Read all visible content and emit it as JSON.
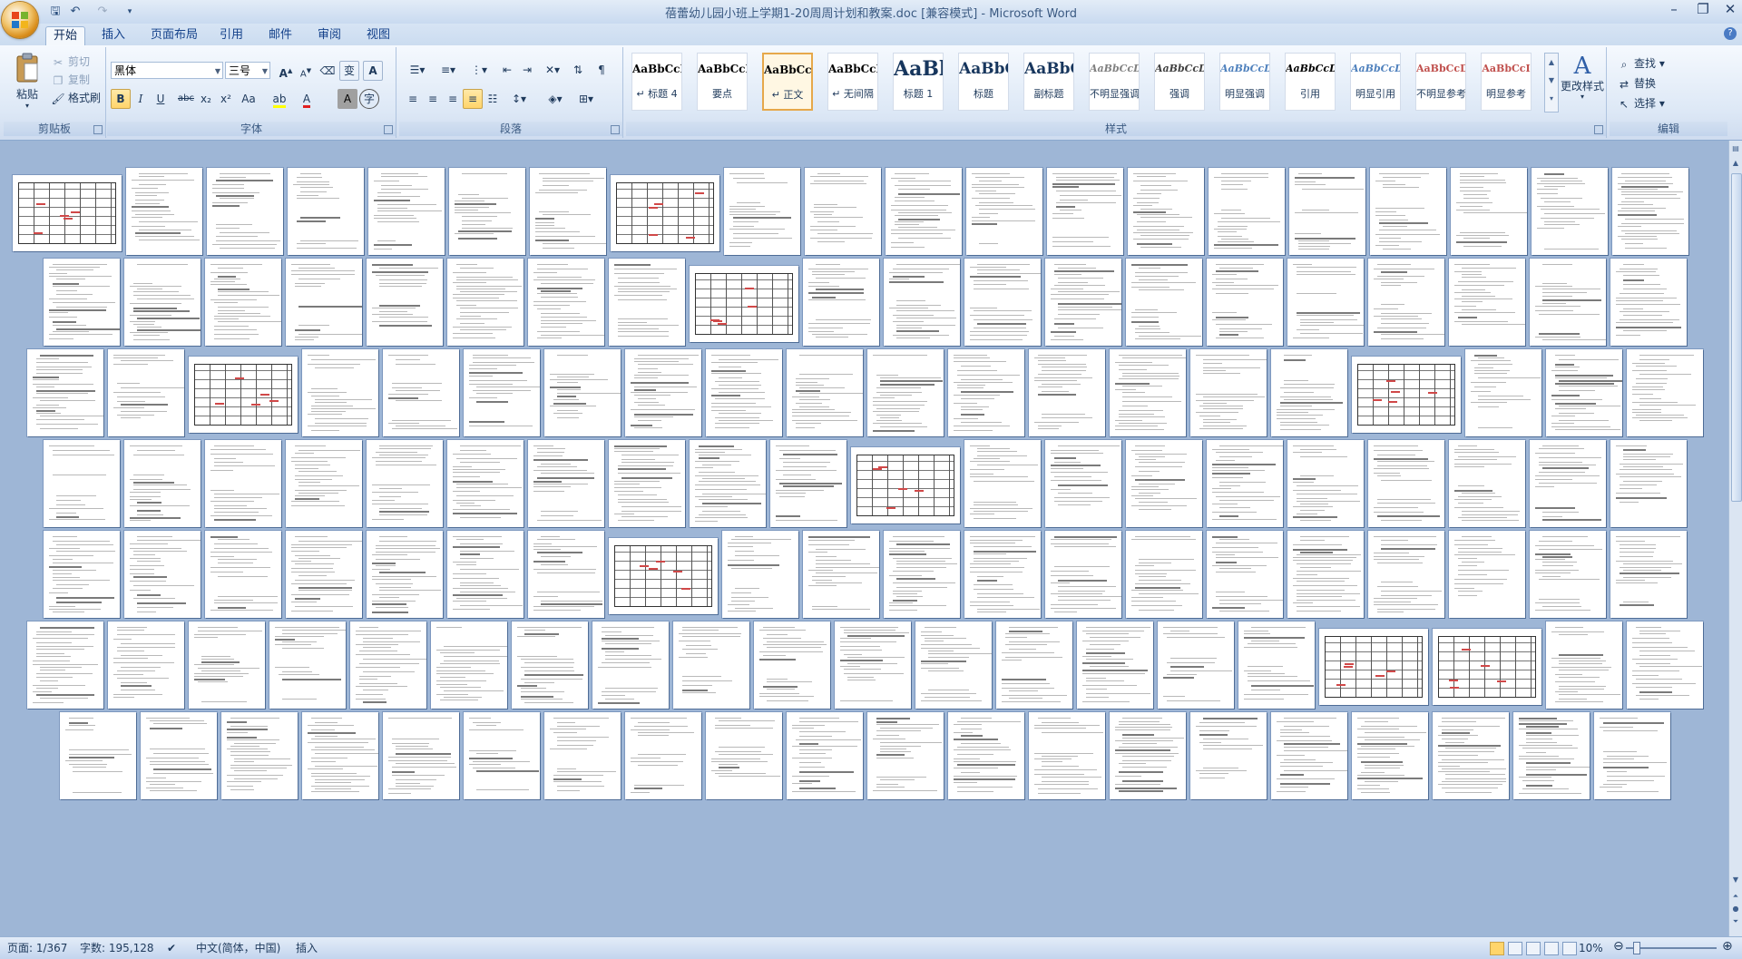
{
  "window": {
    "title": "蓓蕾幼儿园小班上学期1-20周周计划和教案.doc [兼容模式] - Microsoft Word"
  },
  "tabs": [
    "开始",
    "插入",
    "页面布局",
    "引用",
    "邮件",
    "审阅",
    "视图"
  ],
  "clipboard": {
    "paste": "粘贴",
    "cut": "剪切",
    "copy": "复制",
    "format_painter": "格式刷",
    "label": "剪贴板"
  },
  "font": {
    "name": "黑体",
    "size": "三号",
    "label": "字体",
    "grow": "A",
    "shrink": "A",
    "bold": "B",
    "italic": "I",
    "underline": "U",
    "strike": "abc",
    "subscript": "x₂",
    "superscript": "x²",
    "change_case": "Aa",
    "font_color": "A",
    "char_shading": "A",
    "clear": "A",
    "phonetic": "变"
  },
  "paragraph": {
    "label": "段落"
  },
  "styles": {
    "label": "样式",
    "items": [
      {
        "sample": "AaBbCcI",
        "name": "↵ 标题 4"
      },
      {
        "sample": "AaBbCcD",
        "name": "要点"
      },
      {
        "sample": "AaBbCcDc",
        "name": "↵ 正文"
      },
      {
        "sample": "AaBbCcDc",
        "name": "↵ 无间隔"
      },
      {
        "sample": "AaBl",
        "name": "标题 1"
      },
      {
        "sample": "AaBbC(",
        "name": "标题"
      },
      {
        "sample": "AaBbC",
        "name": "副标题"
      },
      {
        "sample": "AaBbCcDi",
        "name": "不明显强调"
      },
      {
        "sample": "AaBbCcDi",
        "name": "强调"
      },
      {
        "sample": "AaBbCcDi",
        "name": "明显强调"
      },
      {
        "sample": "AaBbCcDi",
        "name": "引用"
      },
      {
        "sample": "AaBbCcDi",
        "name": "明显引用"
      },
      {
        "sample": "AaBbCcD",
        "name": "不明显参考"
      },
      {
        "sample": "AaBbCcI",
        "name": "明显参考"
      }
    ],
    "change_styles": "更改样式"
  },
  "editing": {
    "label": "编辑",
    "find": "查找",
    "replace": "替换",
    "select": "选择"
  },
  "status": {
    "page": "页面: 1/367",
    "words": "字数: 195,128",
    "language": "中文(简体，中国)",
    "mode": "插入",
    "zoom": "10%",
    "zoom_level": 0.1
  },
  "colors": {
    "ribbon_bg": "#dde8f6",
    "doc_bg": "#9eb6d6",
    "accent": "#ffd56b"
  }
}
